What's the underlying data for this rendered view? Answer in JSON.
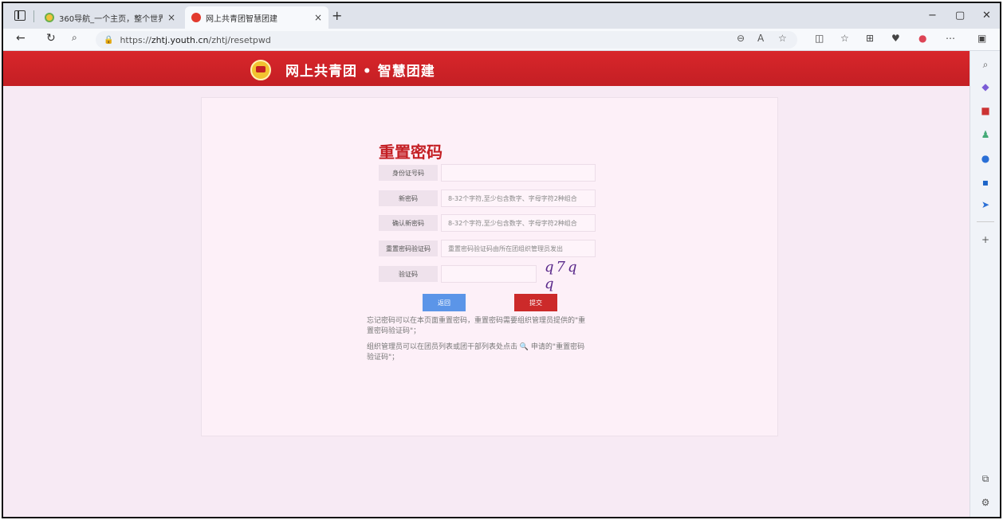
{
  "browser": {
    "tabs": [
      {
        "title": "360导航_一个主页，整个世界",
        "active": false
      },
      {
        "title": "网上共青团智慧团建",
        "active": true
      }
    ],
    "new_tab_symbol": "+",
    "close_symbol": "×",
    "url_prefix": "https://",
    "url_host": "zhtj.youth.cn",
    "url_path": "/zhtj/resetpwd",
    "window_controls": [
      "−",
      "▢",
      "✕"
    ]
  },
  "header": {
    "site_title": "网上共青团 • 智慧团建",
    "colors": {
      "bar": "#c41f24",
      "logo": "#f2c230"
    }
  },
  "form": {
    "title": "重置密码",
    "fields": [
      {
        "label": "身份证号码",
        "placeholder": ""
      },
      {
        "label": "新密码",
        "placeholder": "8-32个字符,至少包含数字、字母字符2种组合"
      },
      {
        "label": "确认新密码",
        "placeholder": "8-32个字符,至少包含数字、字母字符2种组合"
      },
      {
        "label": "重置密码验证码",
        "placeholder": "重置密码验证码由所在团组织管理员发出"
      },
      {
        "label": "验证码",
        "placeholder": ""
      }
    ],
    "captcha_text": "q7q q",
    "back_label": "返回",
    "submit_label": "提交",
    "notes": [
      "忘记密码可以在本页面重置密码，重置密码需要组织管理员提供的\"重置密码验证码\"；",
      "组织管理员可以在团员列表或团干部列表处点击 🔍 申请的\"重置密码验证码\"；"
    ]
  },
  "sidebar": {
    "icons": [
      "search-icon",
      "tag-icon",
      "briefcase-icon",
      "people-icon",
      "circle-icon",
      "outlook-icon",
      "send-icon"
    ],
    "add_symbol": "+"
  }
}
